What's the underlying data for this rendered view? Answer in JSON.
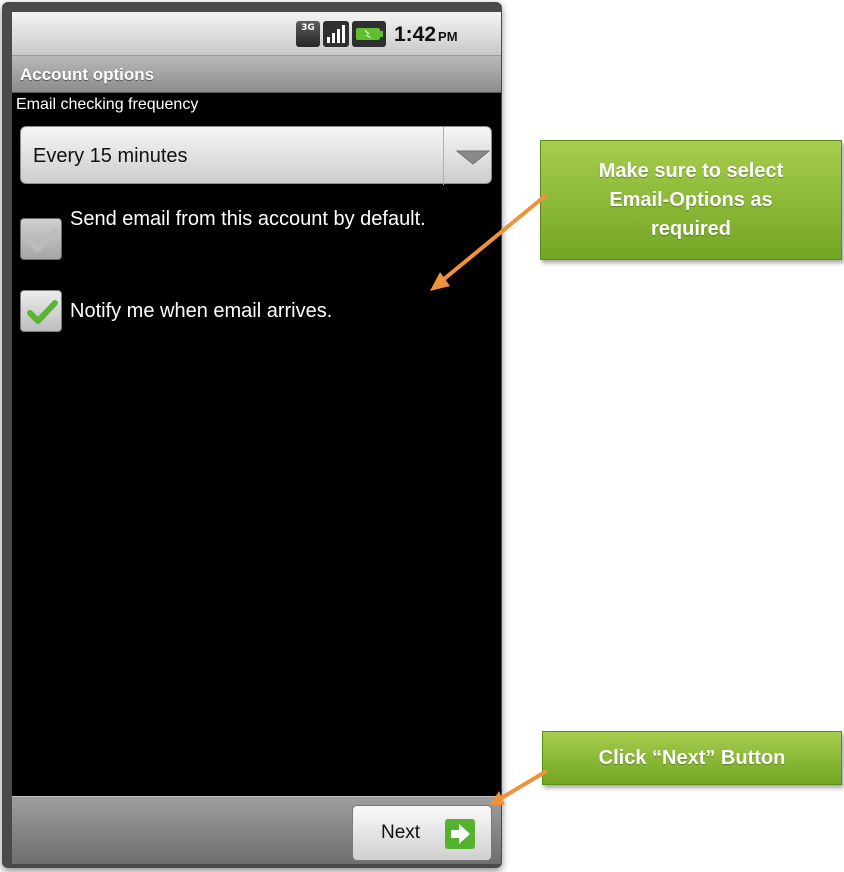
{
  "status_bar": {
    "network_badge": "3G",
    "time": "1:42",
    "ampm": "PM",
    "icons": [
      "3g-icon",
      "signal-icon",
      "battery-charging-icon"
    ]
  },
  "title_bar": {
    "title": "Account options"
  },
  "frequency": {
    "label": "Email checking frequency",
    "selected": "Every 15 minutes"
  },
  "checkboxes": [
    {
      "label": "Send email from this account by default.",
      "checked": true,
      "enabled": false
    },
    {
      "label": "Notify me when email arrives.",
      "checked": true,
      "enabled": true
    }
  ],
  "bottom_bar": {
    "next_label": "Next"
  },
  "callouts": {
    "options_lines": [
      "Make sure to select",
      "Email-Options as",
      "required"
    ],
    "next": "Click “Next” Button"
  },
  "colors": {
    "callout_green": "#8dbd3a",
    "arrow_orange": "#f0923a",
    "check_green": "#5cb532"
  }
}
